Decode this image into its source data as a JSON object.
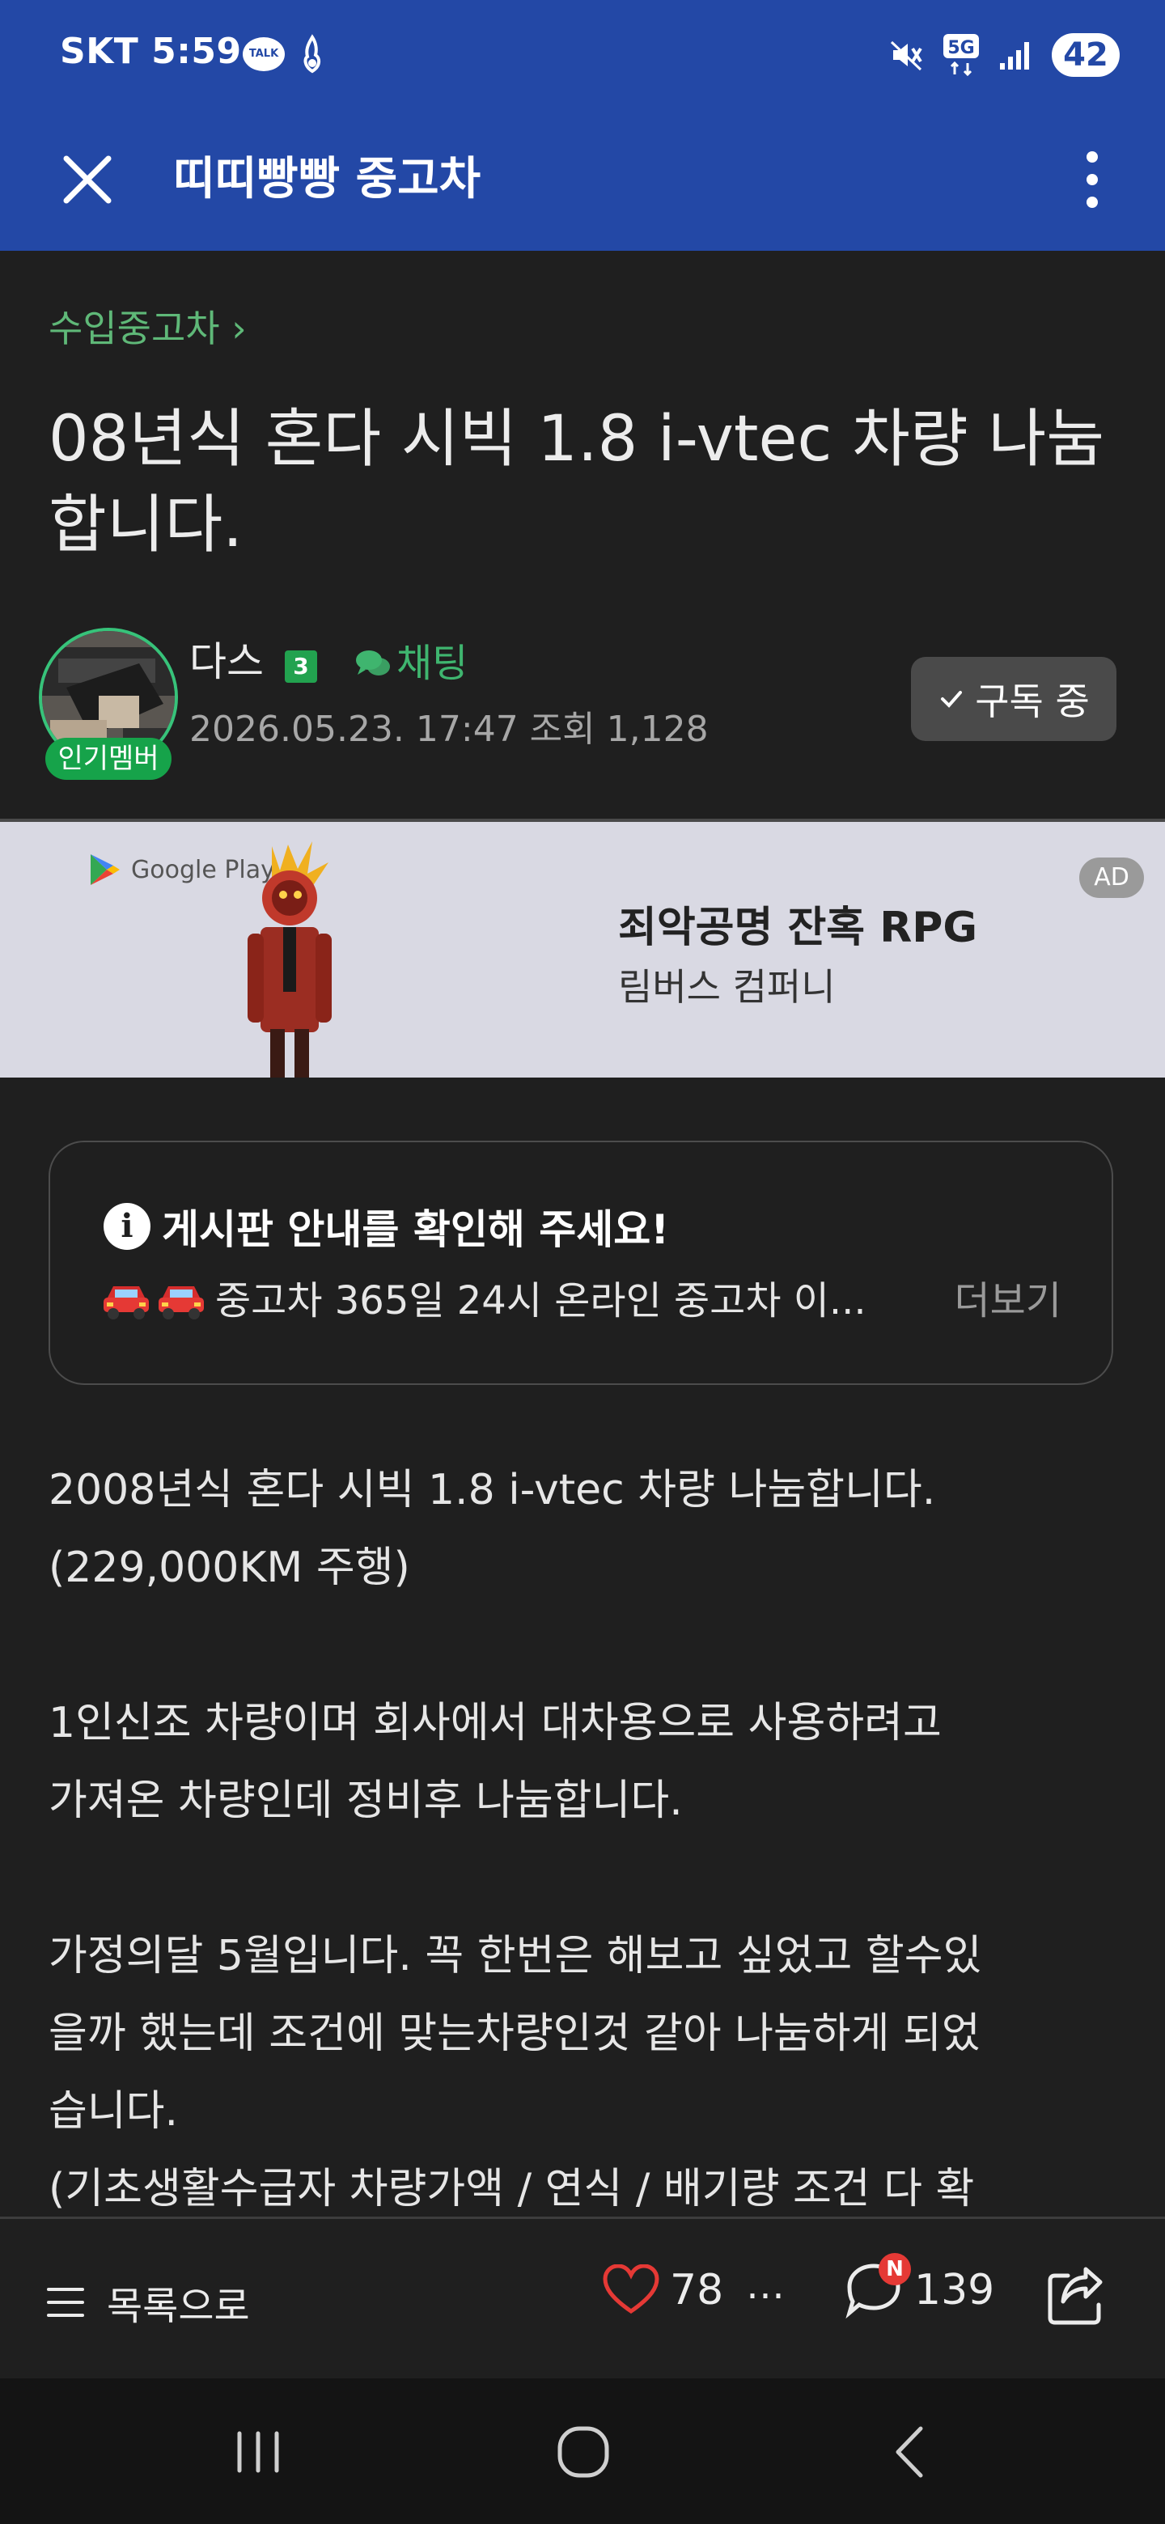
{
  "status_bar": {
    "carrier_time": "SKT 5:59",
    "talk_icon_text": "TALK",
    "network": "5G",
    "battery": "42",
    "icons": [
      "talk-icon",
      "flame-icon",
      "mute-icon",
      "5g-icon",
      "signal-icon",
      "battery-icon"
    ]
  },
  "app_bar": {
    "title": "띠띠빵빵 중고차"
  },
  "post": {
    "breadcrumb": "수입중고차",
    "title": "08년식 혼다 시빅 1.8 i-vtec 차량 나눔합니다.",
    "author": {
      "name": "다스",
      "level": "3",
      "member_badge": "인기멤버",
      "chat_label": "채팅"
    },
    "meta": "2026.05.23. 17:47  조회 1,128",
    "subscribe_label": "구독 중"
  },
  "ad": {
    "store": "Google Play",
    "headline": "죄악공명 잔혹 RPG",
    "company": "림버스 컴퍼니",
    "tag": "AD"
  },
  "notice": {
    "title": "게시판 안내를 확인해 주세요!",
    "body": "중고차 365일 24시 온라인 중고차 이...",
    "more": "더보기"
  },
  "body": {
    "p1_l1": "2008년식 혼다 시빅 1.8 i-vtec 차량 나눔합니다.",
    "p1_l2": "(229,000KM 주행)",
    "p2_l1": "1인신조 차량이며 회사에서 대차용으로 사용하려고",
    "p2_l2": "가져온 차량인데 정비후 나눔합니다.",
    "p3_l1": "가정의달 5월입니다. 꼭 한번은 해보고 싶었고 할수있",
    "p3_l2": "을까 했는데 조건에 맞는차량인것 같아 나눔하게 되었",
    "p3_l3": "습니다.",
    "p3_l4": "(기초생활수급자 차량가액 / 연식 / 배기량 조건 다 확"
  },
  "actions": {
    "list_label": "목록으로",
    "likes": "78",
    "comments": "139",
    "comment_badge": "N"
  },
  "colors": {
    "header_blue": "#2348a6",
    "background": "#1f1f1f",
    "accent_green": "#5fb878",
    "like_red": "#e53935"
  }
}
